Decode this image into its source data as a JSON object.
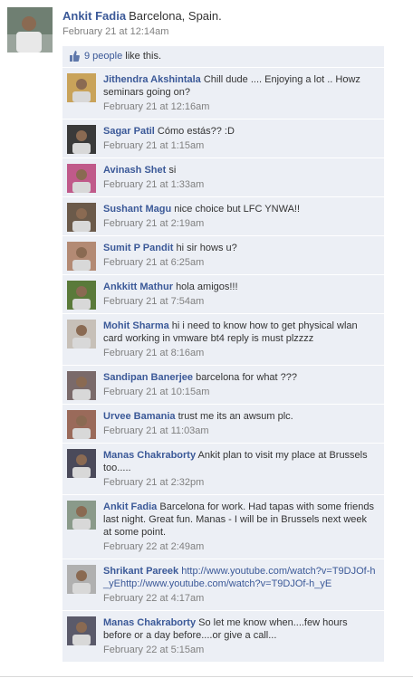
{
  "post": {
    "author": "Ankit Fadia",
    "text": "Barcelona, Spain.",
    "timestamp": "February 21 at 12:14am",
    "avatar_color": "#7d8a7e"
  },
  "likes": {
    "icon": "thumbs-up-icon",
    "count_label": "9 people",
    "suffix": " like this."
  },
  "comments": [
    {
      "author": "Jithendra Akshintala",
      "text": "Chill dude .... Enjoying a lot .. Howz seminars going on?",
      "time": "February 21 at 12:16am"
    },
    {
      "author": "Sagar Patil",
      "text": "Cómo estás?? :D",
      "time": "February 21 at 1:15am"
    },
    {
      "author": "Avinash Shet",
      "text": "si",
      "time": "February 21 at 1:33am"
    },
    {
      "author": "Sushant Magu",
      "text": "nice choice but LFC YNWA!!",
      "time": "February 21 at 2:19am"
    },
    {
      "author": "Sumit P Pandit",
      "text": "hi sir hows u?",
      "time": "February 21 at 6:25am"
    },
    {
      "author": "Ankkitt Mathur",
      "text": "hola amigos!!!",
      "time": "February 21 at 7:54am"
    },
    {
      "author": "Mohit Sharma",
      "text": "hi i need to know how to get physical wlan card working in vmware bt4 reply is must plzzzz",
      "time": "February 21 at 8:16am"
    },
    {
      "author": "Sandipan Banerjee",
      "text": "barcelona for what ???",
      "time": "February 21 at 10:15am"
    },
    {
      "author": "Urvee Bamania",
      "text": "trust me its an awsum plc.",
      "time": "February 21 at 11:03am"
    },
    {
      "author": "Manas Chakraborty",
      "text": "Ankit plan to visit my place at Brussels too.....",
      "time": "February 21 at 2:32pm"
    },
    {
      "author": "Ankit Fadia",
      "text": "Barcelona for work. Had tapas with some friends last night. Great fun. Manas - I will be in Brussels next week at some point.",
      "time": "February 22 at 2:49am"
    },
    {
      "author": "Shrikant Pareek",
      "link": "http://www.youtube.com/watch?v=T9DJOf-h_yEhttp://www.youtube.com/watch?v=T9DJOf-h_yE",
      "time": "February 22 at 4:17am"
    },
    {
      "author": "Manas Chakraborty",
      "text": "So let me know when....few hours before or a day before....or give a call...",
      "time": "February 22 at 5:15am"
    }
  ]
}
